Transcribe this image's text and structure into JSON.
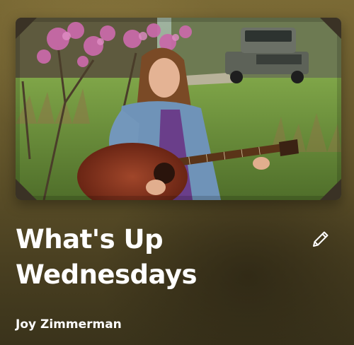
{
  "episode": {
    "title": "What's Up Wednesdays",
    "artist": "Joy Zimmerman"
  },
  "artwork": {
    "subject": "woman playing acoustic guitar in a grassy field beside a flowering redbud tree, pickup truck in background",
    "frame_corner_icon": "photo-corner-icon"
  },
  "controls": {
    "edit_icon": "pencil-icon"
  },
  "colors": {
    "text": "#ffffff",
    "background": "#65572c"
  }
}
